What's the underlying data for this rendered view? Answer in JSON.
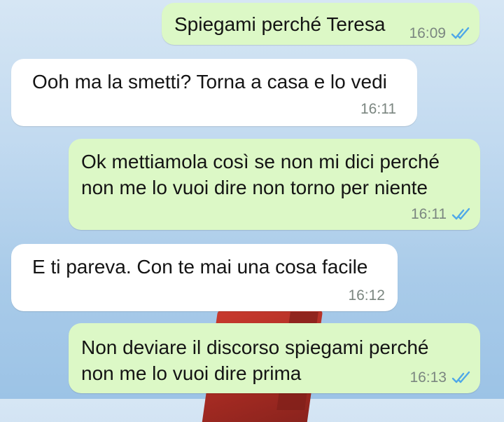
{
  "messages": [
    {
      "direction": "out",
      "text": "Spiegami perché Teresa",
      "time": "16:09",
      "status_icon": "double-check-read-icon"
    },
    {
      "direction": "in",
      "text": "Ooh ma la smetti? Torna a casa e lo vedi",
      "time": "16:11"
    },
    {
      "direction": "out",
      "text": "Ok mettiamola così se non mi dici perché\nnon me lo vuoi dire non torno per niente",
      "time": "16:11",
      "status_icon": "double-check-read-icon"
    },
    {
      "direction": "in",
      "text": "E ti pareva. Con te mai una cosa facile",
      "time": "16:12"
    },
    {
      "direction": "out",
      "text": "Non deviare il discorso spiegami perché\nnon me lo vuoi dire prima",
      "time": "16:13",
      "status_icon": "double-check-read-icon"
    }
  ],
  "colors": {
    "outgoing_bubble": "#dcf8c6",
    "incoming_bubble": "#ffffff",
    "read_check": "#4fa8e8"
  }
}
